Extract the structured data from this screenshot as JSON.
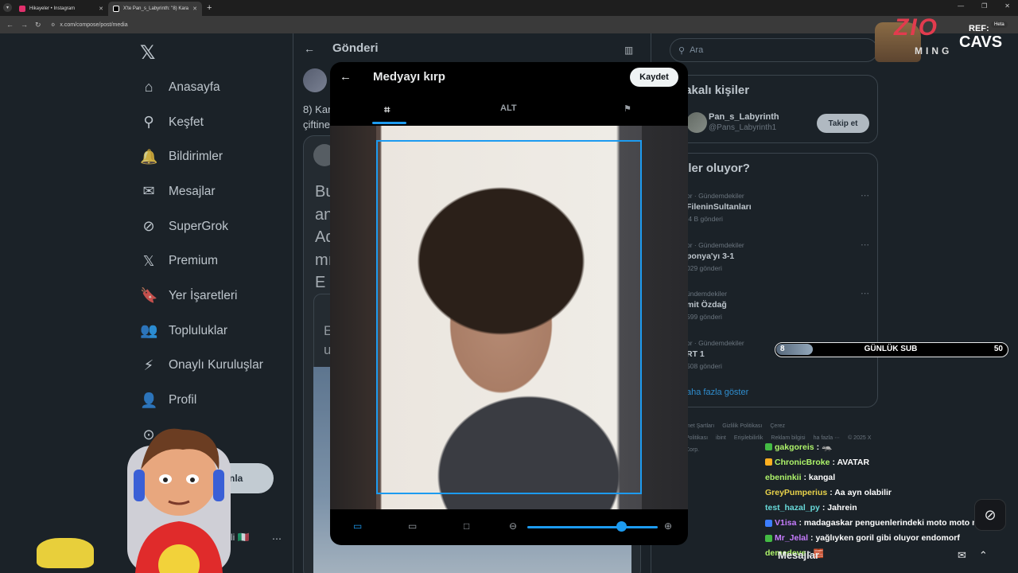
{
  "browser": {
    "tabs": [
      {
        "title": "Hikayeler • Instagram",
        "color": "#e1306c"
      },
      {
        "title": "X'te Pan_s_Labyrinth: \"8) Kara",
        "color": "#ffffff"
      }
    ],
    "url": "x.com/compose/post/media",
    "new_tab": "+",
    "close": "✕"
  },
  "sidebar": {
    "logo": "𝕏",
    "items": [
      {
        "label": "Anasayfa",
        "icon": "⌂"
      },
      {
        "label": "Keşfet",
        "icon": "⚲"
      },
      {
        "label": "Bildirimler",
        "icon": "🔔"
      },
      {
        "label": "Mesajlar",
        "icon": "✉"
      },
      {
        "label": "SuperGrok",
        "icon": "⊘"
      },
      {
        "label": "Premium",
        "icon": "𝕏"
      },
      {
        "label": "Yer İşaretleri",
        "icon": "🔖"
      },
      {
        "label": "Topluluklar",
        "icon": "👥"
      },
      {
        "label": "Onaylı Kuruluşlar",
        "icon": "⚡"
      },
      {
        "label": "Profil",
        "icon": "👤"
      },
      {
        "label": "a",
        "icon": "⊙"
      }
    ],
    "post_button": "ınla",
    "profile_name": "li 🇮🇹",
    "more": "⋯"
  },
  "feed": {
    "title": "Gönderi",
    "back": "←",
    "text_lines": [
      "8) Kar",
      "çiftine"
    ],
    "card_lines": [
      "Bu",
      "an",
      "Ad",
      "mı",
      "E a"
    ],
    "inner_lines": [
      "E",
      "u"
    ]
  },
  "right": {
    "search_placeholder": "Ara",
    "relevant_title": "lakalı kişiler",
    "user": {
      "name": "Pan_s_Labyrinth",
      "handle": "@Pans_Labyrinth1",
      "follow": "Takip et"
    },
    "trends_title": "eler oluyor?",
    "trends": [
      {
        "context": "or · Gündemdekiler",
        "name": "FileninSultanları",
        "count": ",4 B gönderi"
      },
      {
        "context": "or · Gündemdekiler",
        "name": "ponya'yı 3-1",
        "count": "029 gönderi"
      },
      {
        "context": "ündemdekiler",
        "name": "mit Özdağ",
        "count": "599 gönderi"
      },
      {
        "context": "or · Gündemdekiler",
        "name": "RT 1",
        "count": "508 gönderi"
      }
    ],
    "show_more": "aha fazla göster",
    "footer": [
      "met Şartları",
      "Gizlilik Politikası",
      "Çerez Politikası",
      "ibint",
      "Erişilebilirlik",
      "Reklam bilgisi",
      "ha fazla ⋯",
      "© 2025 X Corp."
    ]
  },
  "modal": {
    "title": "Medyayı kırp",
    "back": "←",
    "save": "Kaydet",
    "tabs": {
      "crop": "⌗",
      "alt": "ALT",
      "flag": "⚑"
    },
    "tools": {
      "original": "▭",
      "wide": "▭",
      "square": "□",
      "zoom_out": "⊖",
      "zoom_in": "⊕"
    },
    "zoom_level": 0.72
  },
  "overlay": {
    "logo": "ZIO",
    "logo_sub": "MING",
    "ref_label": "REF:",
    "ref_name": "CAVS",
    "heta": "Heta",
    "sub_goal": {
      "current": "8",
      "label": "GÜNLÜK SUB",
      "goal": "50",
      "fraction": 0.16
    },
    "chat": [
      {
        "user": "gakgoreis",
        "color": "#aef46a",
        "msg": ": 🦡",
        "badge": "#44bb44"
      },
      {
        "user": "ChronicBroke",
        "color": "#aef46a",
        "msg": ": AVATAR",
        "badge": "#ffb020"
      },
      {
        "user": "ebeninkii",
        "color": "#aef46a",
        "msg": ": kangal",
        "badge": ""
      },
      {
        "user": "GreyPumperius",
        "color": "#e8d24a",
        "msg": ": Aa ayn olabilir",
        "badge": ""
      },
      {
        "user": "test_hazal_py",
        "color": "#67d8d8",
        "msg": ": Jahrein",
        "badge": ""
      },
      {
        "user": "V1isa",
        "color": "#c77dff",
        "msg": ": madagaskar penguenlerindeki moto moto mu",
        "badge": "#3d7eff"
      },
      {
        "user": "Mr_Jelal",
        "color": "#c77dff",
        "msg": ": yağlıyken goril gibi oluyor endomorf",
        "badge": "#44bb44"
      },
      {
        "user": "demedeve",
        "color": "#aef46a",
        "msg": ": 🧱",
        "badge": ""
      }
    ],
    "chat_footer": "Mesajlar"
  }
}
